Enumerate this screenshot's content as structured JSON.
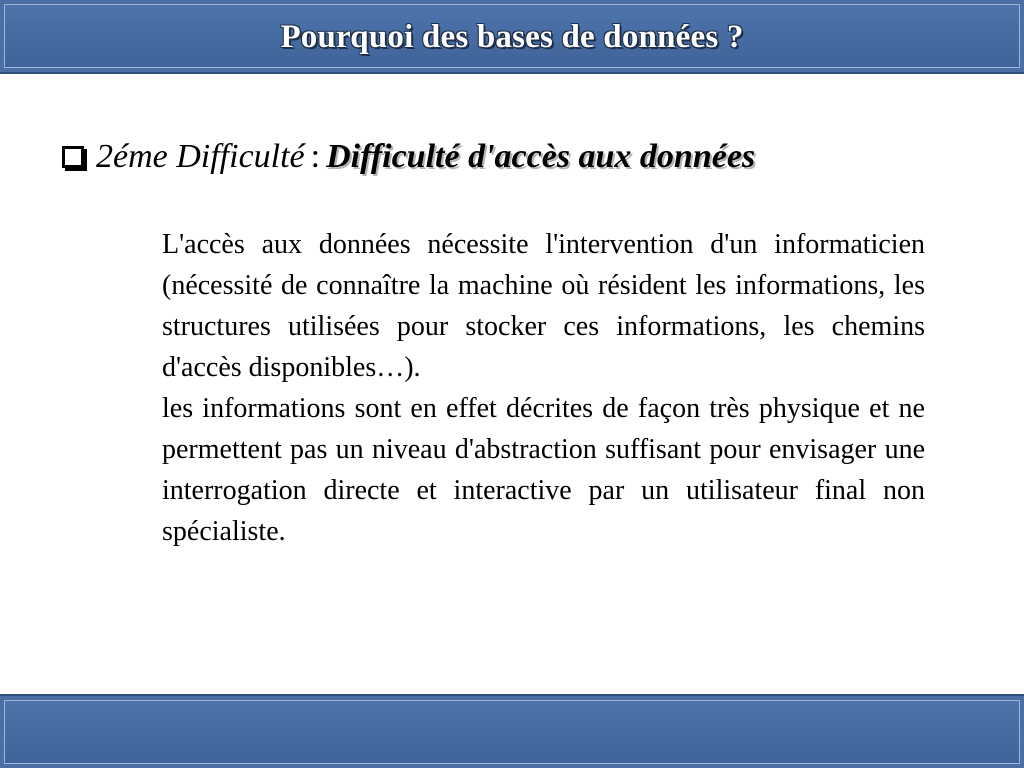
{
  "header": {
    "title": "Pourquoi des bases de données ?"
  },
  "content": {
    "bullet": {
      "label": "2éme Difficulté",
      "separator": ":",
      "heading": "Difficulté d'accès aux données"
    },
    "paragraphs": [
      "L'accès aux données nécessite l'intervention d'un informaticien (nécessité de connaître la machine où résident les informations, les structures utilisées pour stocker ces informations, les chemins d'accès disponibles…).",
      "les informations sont en effet décrites de façon très physique et ne permettent pas un niveau d'abstraction suffisant pour envisager une interrogation directe et interactive par un utilisateur final non spécialiste."
    ]
  },
  "colors": {
    "bar_blue": "#4a6fa5",
    "bar_border": "#2f4f7f",
    "text": "#000000"
  }
}
